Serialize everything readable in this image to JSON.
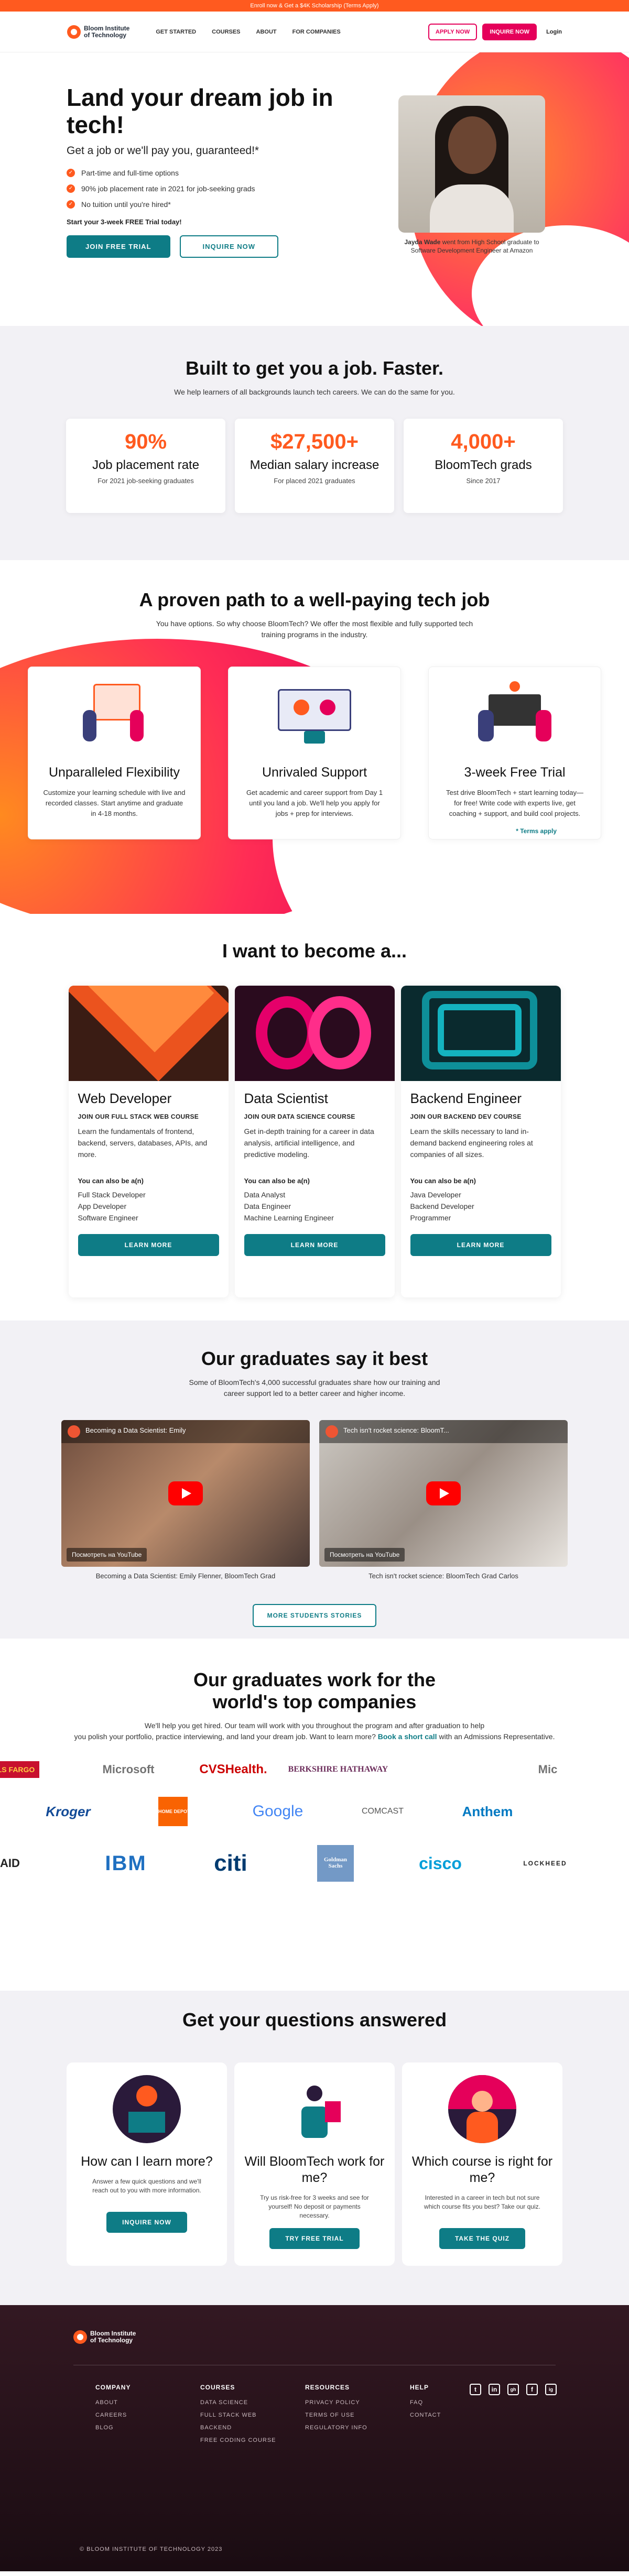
{
  "banner": {
    "text": "Enroll now & Get a $4K Scholarship (Terms Apply)"
  },
  "nav": {
    "logo_line1": "Bloom Institute",
    "logo_line2": "of Technology",
    "links": [
      "GET STARTED",
      "COURSES",
      "ABOUT",
      "FOR COMPANIES"
    ],
    "apply_now": "APPLY NOW",
    "inquire_now": "INQUIRE NOW",
    "login": "Login"
  },
  "hero": {
    "title": "Land your dream job in tech!",
    "subtitle": "Get a job or we'll pay you, guaranteed!*",
    "checks": [
      "Part-time and full-time options",
      "90% job placement rate in 2021 for job-seeking grads",
      "No tuition until you're hired*"
    ],
    "trial_text": "Start your 3-week FREE Trial today!",
    "join_trial": "JOIN FREE TRIAL",
    "inquire_now": "INQUIRE NOW",
    "caption_name": "Jayda Wade",
    "caption_rest": " went from High School graduate to Software Development Engineer at Amazon"
  },
  "built": {
    "title": "Built to get you a job. Faster.",
    "lead": "We help learners of all backgrounds launch tech careers. We can do the same for you.",
    "stats": [
      {
        "num": "90%",
        "label": "Job placement rate",
        "sub": "For 2021 job-seeking graduates"
      },
      {
        "num": "$27,500+",
        "label": "Median salary increase",
        "sub": "For placed 2021 graduates"
      },
      {
        "num": "4,000+",
        "label": "BloomTech grads",
        "sub": "Since 2017"
      }
    ]
  },
  "path": {
    "title": "A proven path to a well-paying tech job",
    "lead1": "You have options. So why choose BloomTech? We offer the most flexible and fully supported tech",
    "lead2": "training programs in the industry.",
    "cards": [
      {
        "title": "Unparalleled Flexibility",
        "text": "Customize your learning schedule with live and recorded classes. Start anytime and graduate in 4-18 months."
      },
      {
        "title": "Unrivaled Support",
        "text": "Get academic and career support from Day 1 until you land a job. We'll help you apply for jobs + prep for interviews."
      },
      {
        "title": "3-week Free Trial",
        "text": "Test drive BloomTech + start learning today—for free! Write code with experts live, get coaching + support, and build cool projects."
      }
    ],
    "terms": "* Terms apply"
  },
  "become": {
    "title": "I want to become a...",
    "also_label": "You can also be a(n)",
    "tracks": [
      {
        "title": "Web Developer",
        "course": "JOIN OUR FULL STACK WEB COURSE",
        "desc": "Learn the fundamentals of frontend, backend, servers, databases, APIs, and more.",
        "roles": [
          "Full Stack Developer",
          "App Developer",
          "Software Engineer"
        ],
        "button": "LEARN MORE"
      },
      {
        "title": "Data Scientist",
        "course": "JOIN OUR DATA SCIENCE COURSE",
        "desc": "Get in-depth training for a career in data analysis, artificial intelligence, and predictive modeling.",
        "roles": [
          "Data Analyst",
          "Data Engineer",
          "Machine Learning Engineer"
        ],
        "button": "LEARN MORE"
      },
      {
        "title": "Backend Engineer",
        "course": "JOIN OUR BACKEND DEV COURSE",
        "desc": "Learn the skills necessary to land in-demand backend engineering roles at companies of all sizes.",
        "roles": [
          "Java Developer",
          "Backend Developer",
          "Programmer"
        ],
        "button": "LEARN MORE"
      }
    ]
  },
  "grads": {
    "title": "Our graduates say it best",
    "lead1": "Some of BloomTech's 4,000 successful graduates share how our training and",
    "lead2": "career support led to a better career and higher income.",
    "videos": [
      {
        "title": "Becoming a Data Scientist: Emily",
        "watch": "Посмотреть на YouTube",
        "caption": "Becoming a Data Scientist: Emily Flenner, BloomTech Grad"
      },
      {
        "title": "Tech isn't rocket science: BloomT...",
        "watch": "Посмотреть на YouTube",
        "caption": "Tech isn't rocket science: BloomTech Grad Carlos"
      }
    ],
    "more": "MORE STUDENTS STORIES"
  },
  "companies": {
    "title1": "Our graduates work for the",
    "title2": "world's top companies",
    "lead1": "We'll help you get hired. Our team will work with you throughout the program and after graduation to help",
    "lead2": "you polish your portfolio, practice interviewing, and land your dream job. Want to learn more?",
    "lead_link": "Book a short call",
    "lead3": " with an Admissions Representative.",
    "row1": [
      "WELLS FARGO",
      "Microsoft",
      "CVSHealth.",
      "BERKSHIRE HATHAWAY",
      "",
      "Mic"
    ],
    "row2": [
      "Kroger",
      "HOME DEPOT",
      "Google",
      "COMCAST",
      "Anthem"
    ],
    "row3": [
      "AID",
      "IBM",
      "citi",
      "Goldman Sachs",
      "cisco",
      "LOCKHEED"
    ]
  },
  "faq": {
    "title": "Get your questions answered",
    "cards": [
      {
        "title": "How can I learn more?",
        "text": "Answer a few quick questions and we'll reach out to you with more information.",
        "button": "INQUIRE NOW"
      },
      {
        "title": "Will BloomTech work for me?",
        "text": "Try us risk-free for 3 weeks and see for yourself! No deposit or payments necessary.",
        "button": "TRY FREE TRIAL"
      },
      {
        "title": "Which course is right for me?",
        "text": "Interested in a career in tech but not sure which course fits you best? Take our quiz.",
        "button": "TAKE THE QUIZ"
      }
    ]
  },
  "footer": {
    "cols": [
      {
        "head": "COMPANY",
        "items": [
          "ABOUT",
          "CAREERS",
          "BLOG"
        ]
      },
      {
        "head": "COURSES",
        "items": [
          "DATA SCIENCE",
          "FULL STACK WEB",
          "BACKEND",
          "FREE CODING COURSE"
        ]
      },
      {
        "head": "RESOURCES",
        "items": [
          "PRIVACY POLICY",
          "TERMS OF USE",
          "REGULATORY INFO"
        ]
      },
      {
        "head": "HELP",
        "items": [
          "FAQ",
          "CONTACT"
        ]
      }
    ],
    "socials": [
      "t",
      "in",
      "gh",
      "f",
      "ig"
    ],
    "copyright": "© BLOOM INSTITUTE OF TECHNOLOGY 2023"
  },
  "colors": {
    "accent": "#ff5a1f",
    "pink": "#e5005a",
    "teal": "#0e7c86"
  }
}
